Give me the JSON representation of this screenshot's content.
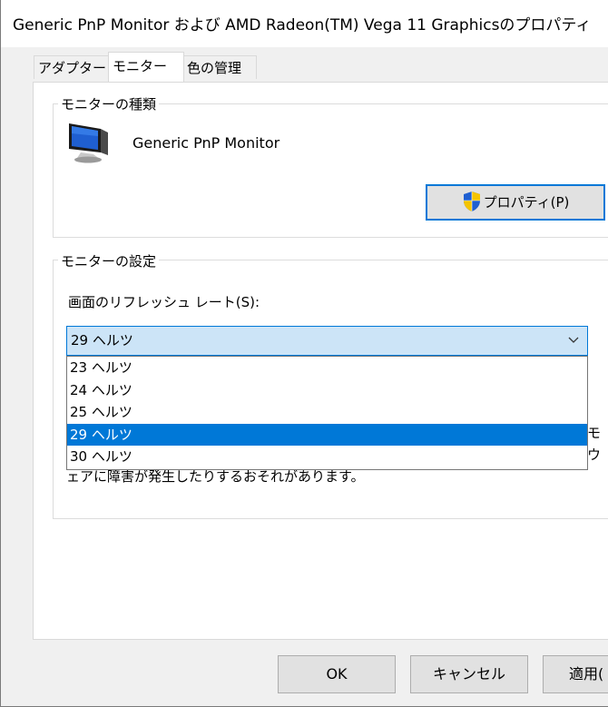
{
  "window": {
    "title": "Generic PnP Monitor および AMD Radeon(TM) Vega 11 Graphicsのプロパティ"
  },
  "tabs": [
    {
      "label": "アダプター"
    },
    {
      "label": "モニター"
    },
    {
      "label": "色の管理"
    }
  ],
  "monitor_type": {
    "group_label": "モニターの種類",
    "monitor_name": "Generic PnP Monitor",
    "properties_button": "プロパティ(P)",
    "icon": "monitor-icon",
    "button_icon": "uac-shield-icon"
  },
  "monitor_settings": {
    "group_label": "モニターの設定",
    "refresh_label": "画面のリフレッシュ レート(S):",
    "selected_rate": "29 ヘルツ",
    "options": [
      "23 ヘルツ",
      "24 ヘルツ",
      "25 ヘルツ",
      "29 ヘルツ",
      "30 ヘルツ"
    ],
    "selected_index": 3,
    "warning_fragment_1": "モ",
    "warning_fragment_2": "ウ",
    "warning_fragment_3": "ェアに障害が発生したりするおそれがあります。"
  },
  "buttons": {
    "ok": "OK",
    "cancel": "キャンセル",
    "apply": "適用("
  },
  "colors": {
    "accent": "#0078d7",
    "select_bg": "#cce4f7",
    "dialog_bg": "#f0f0f0"
  }
}
